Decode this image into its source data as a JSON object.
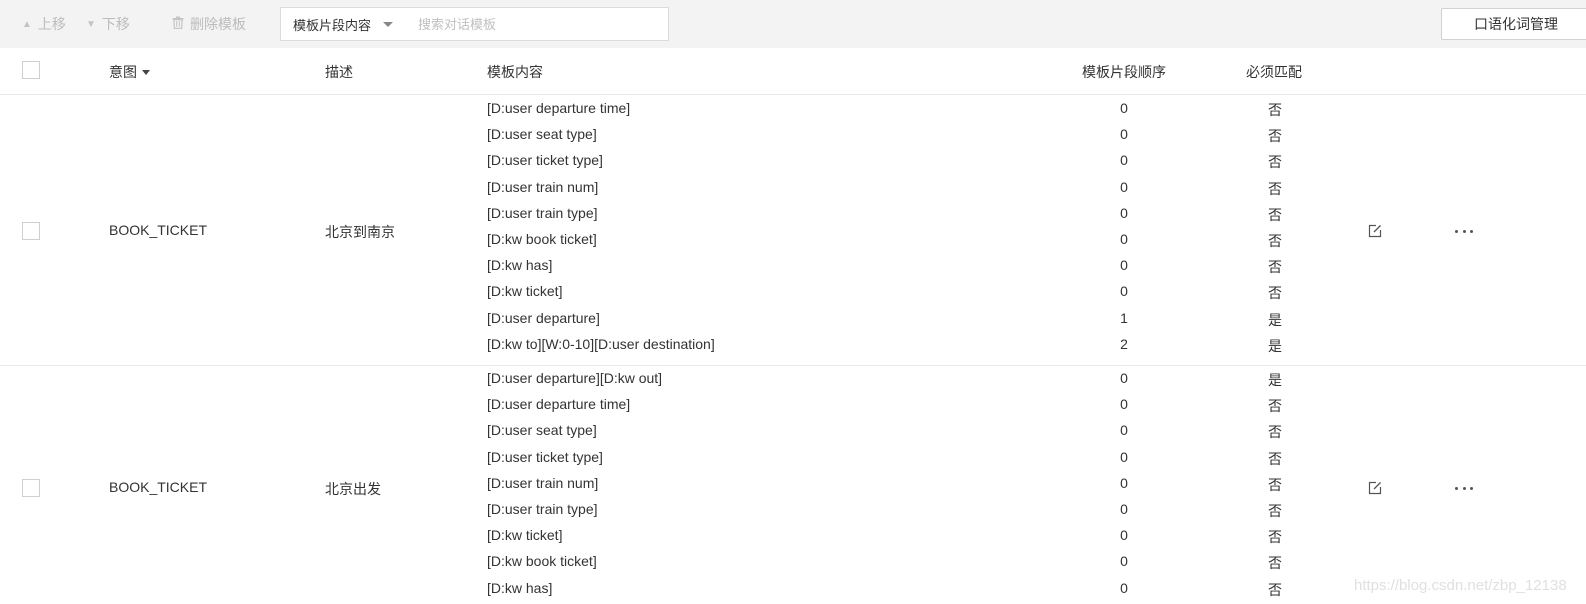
{
  "toolbar": {
    "move_up_label": "上移",
    "move_down_label": "下移",
    "delete_label": "删除模板",
    "filter_selected": "模板片段内容",
    "search_placeholder": "搜索对话模板",
    "manage_label": "口语化词管理"
  },
  "table": {
    "headers": {
      "intent": "意图",
      "desc": "描述",
      "content": "模板内容",
      "order": "模板片段顺序",
      "must": "必须匹配"
    },
    "rows": [
      {
        "intent": "BOOK_TICKET",
        "desc": "北京到南京",
        "segments": [
          {
            "content": "[D:user departure time]",
            "order": "0",
            "must": "否"
          },
          {
            "content": "[D:user seat type]",
            "order": "0",
            "must": "否"
          },
          {
            "content": "[D:user ticket type]",
            "order": "0",
            "must": "否"
          },
          {
            "content": "[D:user train num]",
            "order": "0",
            "must": "否"
          },
          {
            "content": "[D:user train type]",
            "order": "0",
            "must": "否"
          },
          {
            "content": "[D:kw book ticket]",
            "order": "0",
            "must": "否"
          },
          {
            "content": "[D:kw has]",
            "order": "0",
            "must": "否"
          },
          {
            "content": "[D:kw ticket]",
            "order": "0",
            "must": "否"
          },
          {
            "content": "[D:user departure]",
            "order": "1",
            "must": "是"
          },
          {
            "content": "[D:kw to][W:0-10][D:user destination]",
            "order": "2",
            "must": "是"
          }
        ]
      },
      {
        "intent": "BOOK_TICKET",
        "desc": "北京出发",
        "segments": [
          {
            "content": "[D:user departure][D:kw out]",
            "order": "0",
            "must": "是"
          },
          {
            "content": "[D:user departure time]",
            "order": "0",
            "must": "否"
          },
          {
            "content": "[D:user seat type]",
            "order": "0",
            "must": "否"
          },
          {
            "content": "[D:user ticket type]",
            "order": "0",
            "must": "否"
          },
          {
            "content": "[D:user train num]",
            "order": "0",
            "must": "否"
          },
          {
            "content": "[D:user train type]",
            "order": "0",
            "must": "否"
          },
          {
            "content": "[D:kw ticket]",
            "order": "0",
            "must": "否"
          },
          {
            "content": "[D:kw book ticket]",
            "order": "0",
            "must": "否"
          },
          {
            "content": "[D:kw has]",
            "order": "0",
            "must": "否"
          }
        ]
      }
    ]
  },
  "watermark": "https://blog.csdn.net/zbp_12138"
}
